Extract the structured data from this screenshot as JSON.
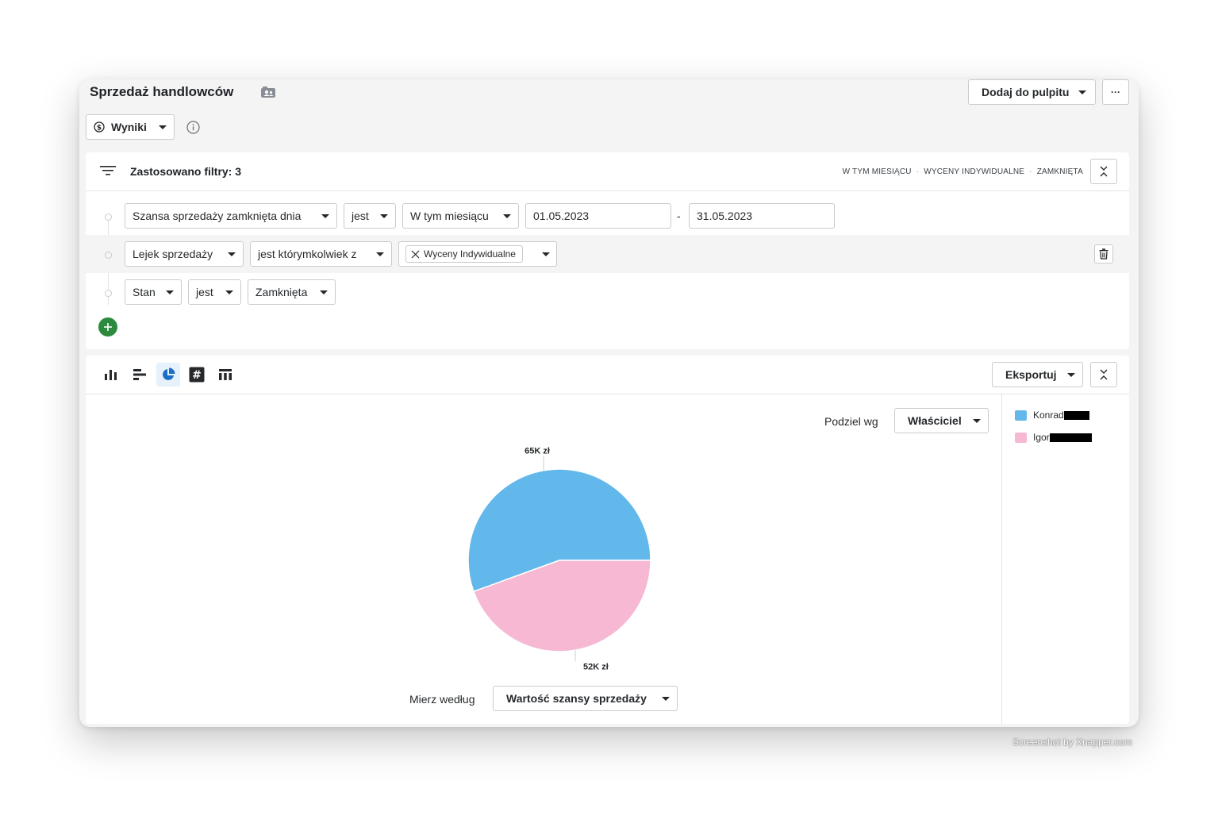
{
  "header": {
    "title": "Sprzedaż handlowców",
    "add_to_dashboard": "Dodaj do pulpitu",
    "more": "···"
  },
  "report_type": {
    "label": "Wyniki"
  },
  "filters": {
    "heading": "Zastosowano filtry: 3",
    "tags": [
      "W TYM MIESIĄCU",
      "WYCENY INDYWIDUALNE",
      "ZAMKNIĘTA"
    ],
    "rows": [
      {
        "field": "Szansa sprzedaży zamknięta dnia",
        "operator": "jest",
        "value": "W tym miesiącu",
        "date_from": "01.05.2023",
        "date_sep": "-",
        "date_to": "31.05.2023"
      },
      {
        "field": "Lejek sprzedaży",
        "operator": "jest którymkolwiek z",
        "chip": "Wyceny Indywidualne"
      },
      {
        "field": "Stan",
        "operator": "jest",
        "value": "Zamknięta"
      }
    ]
  },
  "toolbar": {
    "export": "Eksportuj"
  },
  "split": {
    "label": "Podziel wg",
    "value": "Właściciel"
  },
  "measure": {
    "label": "Mierz według",
    "value": "Wartość szansy sprzedaży"
  },
  "legend": [
    {
      "name": "Konrad",
      "color": "#62b8ea"
    },
    {
      "name": "Igor",
      "color": "#f6b8d3"
    }
  ],
  "chart_data": {
    "type": "pie",
    "categories": [
      "Konrad",
      "Igor"
    ],
    "values": [
      65,
      52
    ],
    "labels": [
      "65K zł",
      "52K zł"
    ],
    "colors": [
      "#62b8ea",
      "#f6b8d3"
    ]
  },
  "watermark": "Screenshot by Xnapper.com"
}
